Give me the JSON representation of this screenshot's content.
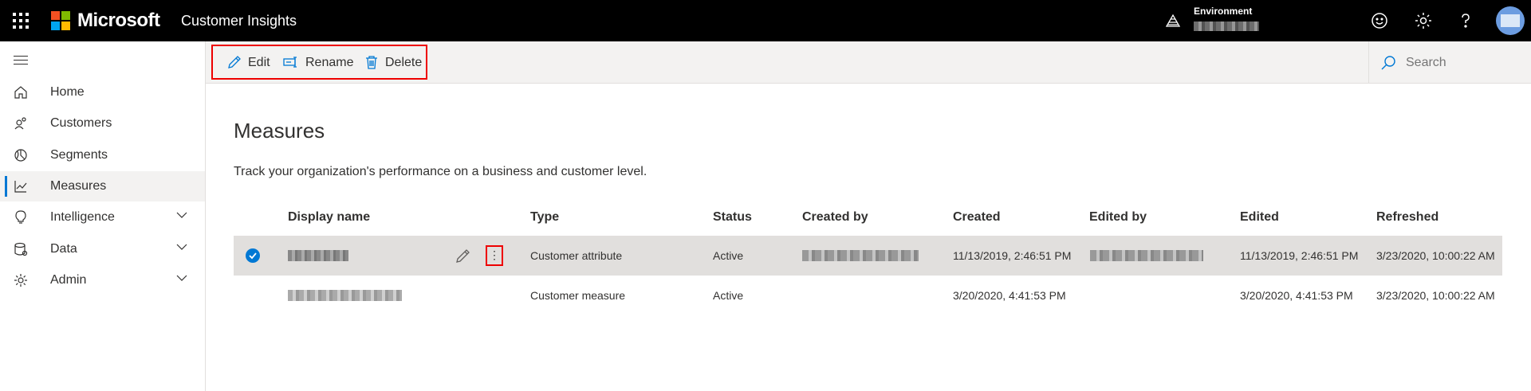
{
  "topbar": {
    "brand": "Microsoft",
    "app_name": "Customer Insights",
    "environment_label": "Environment",
    "icons": [
      "waffle-icon",
      "environment-icon",
      "smiley-icon",
      "gear-icon",
      "help-icon",
      "avatar"
    ]
  },
  "sidebar": {
    "items": [
      {
        "label": "Home",
        "icon": "home-icon",
        "expandable": false
      },
      {
        "label": "Customers",
        "icon": "customers-icon",
        "expandable": false
      },
      {
        "label": "Segments",
        "icon": "segments-icon",
        "expandable": false
      },
      {
        "label": "Measures",
        "icon": "measures-icon",
        "expandable": false,
        "active": true
      },
      {
        "label": "Intelligence",
        "icon": "lightbulb-icon",
        "expandable": true
      },
      {
        "label": "Data",
        "icon": "data-icon",
        "expandable": true
      },
      {
        "label": "Admin",
        "icon": "gear-icon",
        "expandable": true
      }
    ]
  },
  "commands": {
    "edit": "Edit",
    "rename": "Rename",
    "delete": "Delete"
  },
  "search": {
    "placeholder": "Search"
  },
  "page": {
    "title": "Measures",
    "description": "Track your organization's performance on a business and customer level."
  },
  "table": {
    "columns": [
      "Display name",
      "Type",
      "Status",
      "Created by",
      "Created",
      "Edited by",
      "Edited",
      "Refreshed"
    ],
    "rows": [
      {
        "selected": true,
        "type": "Customer attribute",
        "status": "Active",
        "created": "11/13/2019, 2:46:51 PM",
        "edited": "11/13/2019, 2:46:51 PM",
        "refreshed": "3/23/2020, 10:00:22 AM"
      },
      {
        "selected": false,
        "type": "Customer measure",
        "status": "Active",
        "created": "3/20/2020, 4:41:53 PM",
        "edited": "3/20/2020, 4:41:53 PM",
        "refreshed": "3/23/2020, 10:00:22 AM"
      }
    ]
  },
  "colors": {
    "accent": "#0078d4",
    "highlight": "#ee0000",
    "topbar": "#000000"
  }
}
